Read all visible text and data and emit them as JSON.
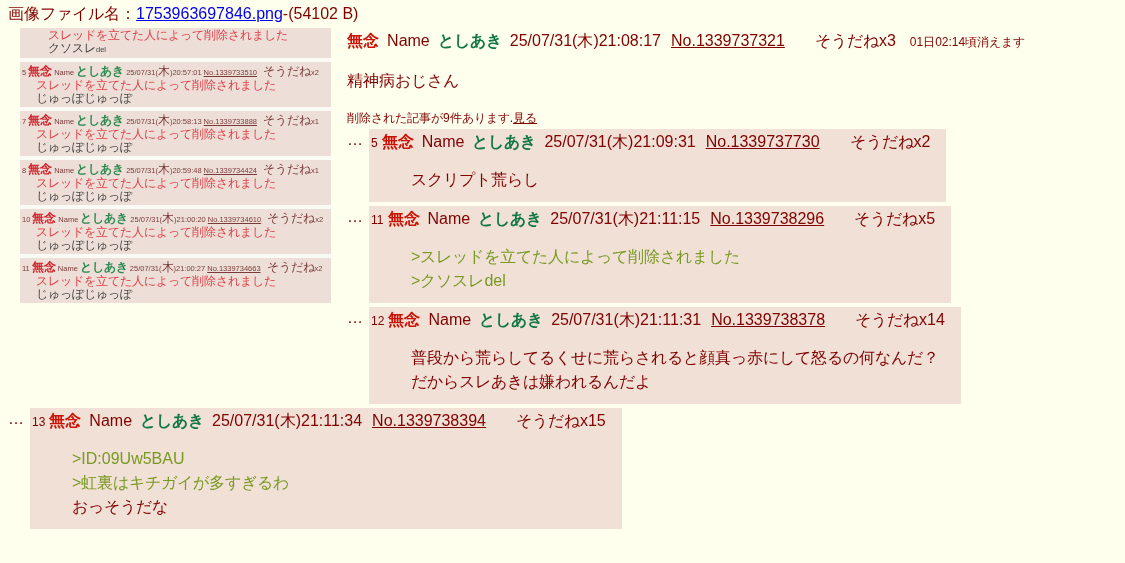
{
  "attachment": {
    "label": "画像ファイル名：",
    "filename": "1753963697846.png",
    "size": "-(54102 B)",
    "image": {
      "top_lines": [
        {
          "kind": "deleted",
          "text": "スレッドを立てた人によって削除されました"
        },
        {
          "kind": "plain",
          "text": "クソスレdel"
        }
      ],
      "posts": [
        {
          "number": "5",
          "mark": "無念",
          "name": "Name",
          "author": "としあき",
          "date": "25/07/31(木)20:57:01",
          "no": "No.1339733510",
          "sodane": "そうだねx2",
          "lines": [
            {
              "kind": "deleted",
              "text": "スレッドを立てた人によって削除されました"
            },
            {
              "kind": "plain",
              "text": "じゅっぽじゅっぽ"
            }
          ]
        },
        {
          "number": "7",
          "mark": "無念",
          "name": "Name",
          "author": "としあき",
          "date": "25/07/31(木)20:58:13",
          "no": "No.1339733888",
          "sodane": "そうだねx1",
          "lines": [
            {
              "kind": "deleted",
              "text": "スレッドを立てた人によって削除されました"
            },
            {
              "kind": "plain",
              "text": "じゅっぽじゅっぽ"
            }
          ]
        },
        {
          "number": "8",
          "mark": "無念",
          "name": "Name",
          "author": "としあき",
          "date": "25/07/31(木)20:59:48",
          "no": "No.1339734424",
          "sodane": "そうだねx1",
          "lines": [
            {
              "kind": "deleted",
              "text": "スレッドを立てた人によって削除されました"
            },
            {
              "kind": "plain",
              "text": "じゅっぽじゅっぽ"
            }
          ]
        },
        {
          "number": "10",
          "mark": "無念",
          "name": "Name",
          "author": "としあき",
          "date": "25/07/31(木)21:00:20",
          "no": "No.1339734610",
          "sodane": "そうだねx2",
          "lines": [
            {
              "kind": "deleted",
              "text": "スレッドを立てた人によって削除されました"
            },
            {
              "kind": "plain",
              "text": "じゅっぽじゅっぽ"
            }
          ]
        },
        {
          "number": "11",
          "mark": "無念",
          "name": "Name",
          "author": "としあき",
          "date": "25/07/31(木)21:00:27",
          "no": "No.1339734663",
          "sodane": "そうだねx2",
          "lines": [
            {
              "kind": "deleted",
              "text": "スレッドを立てた人によって削除されました"
            },
            {
              "kind": "plain",
              "text": "じゅっぽじゅっぽ"
            }
          ]
        }
      ]
    }
  },
  "thread": {
    "mark": "無念",
    "name": "Name",
    "author": "としあき",
    "date": "25/07/31(木)21:08:17",
    "no": "No.1339737321",
    "sodane": "そうだねx3",
    "expiry": "01日02:14頃消えます",
    "body": "精神病おじさん",
    "deleted_notice": "削除された記事が9件あります.",
    "deleted_link": "見る"
  },
  "replies": [
    {
      "ellipsis": "…",
      "number": "5",
      "mark": "無念",
      "name": "Name",
      "author": "としあき",
      "date": "25/07/31(木)21:09:31",
      "no": "No.1339737730",
      "sodane": "そうだねx2",
      "lines": [
        {
          "kind": "plain",
          "text": "スクリプト荒らし"
        }
      ]
    },
    {
      "ellipsis": "…",
      "number": "11",
      "mark": "無念",
      "name": "Name",
      "author": "としあき",
      "date": "25/07/31(木)21:11:15",
      "no": "No.1339738296",
      "sodane": "そうだねx5",
      "lines": [
        {
          "kind": "quote",
          "text": ">スレッドを立てた人によって削除されました"
        },
        {
          "kind": "quote",
          "text": ">クソスレdel"
        }
      ]
    },
    {
      "ellipsis": "…",
      "number": "12",
      "mark": "無念",
      "name": "Name",
      "author": "としあき",
      "date": "25/07/31(木)21:11:31",
      "no": "No.1339738378",
      "sodane": "そうだねx14",
      "lines": [
        {
          "kind": "plain",
          "text": "普段から荒らしてるくせに荒らされると顔真っ赤にして怒るの何なんだ？"
        },
        {
          "kind": "plain",
          "text": "だからスレあきは嫌われるんだよ"
        }
      ]
    },
    {
      "ellipsis": "…",
      "number": "13",
      "mark": "無念",
      "name": "Name",
      "author": "としあき",
      "date": "25/07/31(木)21:11:34",
      "no": "No.1339738394",
      "sodane": "そうだねx15",
      "lines": [
        {
          "kind": "quote",
          "text": ">ID:09Uw5BAU"
        },
        {
          "kind": "quote",
          "text": ">虹裏はキチガイが多すぎるわ"
        },
        {
          "kind": "plain",
          "text": "おっそうだな"
        }
      ]
    }
  ]
}
